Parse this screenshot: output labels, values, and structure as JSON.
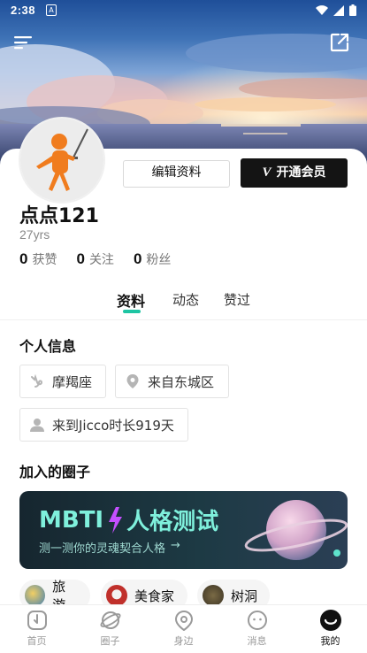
{
  "status_bar": {
    "time": "2:38"
  },
  "profile": {
    "name": "点点121",
    "age": "27yrs",
    "edit_label": "编辑资料",
    "vip_label": "开通会员",
    "vip_badge": "V",
    "stats": [
      {
        "value": "0",
        "label": "获赞"
      },
      {
        "value": "0",
        "label": "关注"
      },
      {
        "value": "0",
        "label": "粉丝"
      }
    ]
  },
  "tabs": [
    {
      "label": "资料",
      "active": true
    },
    {
      "label": "动态",
      "active": false
    },
    {
      "label": "赞过",
      "active": false
    }
  ],
  "personal_info": {
    "title": "个人信息",
    "chips": [
      {
        "icon": "zodiac-capricorn-icon",
        "text": "摩羯座"
      },
      {
        "icon": "location-pin-icon",
        "text": "来自东城区"
      },
      {
        "icon": "person-icon",
        "text": "来到Jicco时长919天"
      }
    ]
  },
  "circles": {
    "title": "加入的圈子",
    "banner": {
      "title_prefix": "MBTI",
      "title_suffix": "人格测试",
      "subtitle": "测一测你的灵魂契合人格",
      "arrow": "→"
    },
    "items": [
      {
        "label": "旅游"
      },
      {
        "label": "美食家"
      },
      {
        "label": "树洞"
      }
    ]
  },
  "nav": [
    {
      "label": "首页",
      "icon": "home-icon",
      "active": false
    },
    {
      "label": "圈子",
      "icon": "planet-icon",
      "active": false
    },
    {
      "label": "身边",
      "icon": "nearby-pin-icon",
      "active": false
    },
    {
      "label": "消息",
      "icon": "message-icon",
      "active": false
    },
    {
      "label": "我的",
      "icon": "me-icon",
      "active": true
    }
  ],
  "colors": {
    "accent": "#1ec5a3",
    "vip_bg": "#141414",
    "banner_gradient_start": "#1b2e3a"
  }
}
